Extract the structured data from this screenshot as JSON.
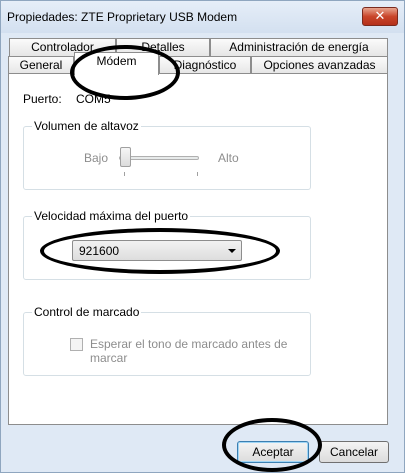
{
  "window": {
    "title": "Propiedades: ZTE Proprietary USB Modem",
    "close_glyph": "✕"
  },
  "tabs": {
    "row_back": [
      {
        "label": "Controlador"
      },
      {
        "label": "Detalles"
      },
      {
        "label": "Administración de energía"
      }
    ],
    "row_front": [
      {
        "label": "General"
      },
      {
        "label": "Módem"
      },
      {
        "label": "Diagnóstico"
      },
      {
        "label": "Opciones avanzadas"
      }
    ]
  },
  "modem_tab": {
    "port_label": "Puerto:",
    "port_value": "COM5",
    "speaker_volume": {
      "title": "Volumen de altavoz",
      "low_label": "Bajo",
      "high_label": "Alto",
      "level_fraction": 0
    },
    "max_port_speed": {
      "title": "Velocidad máxima del puerto",
      "selected": "921600"
    },
    "dial_control": {
      "title": "Control de marcado",
      "wait_dial_tone_label": "Esperar el tono de marcado antes de marcar",
      "wait_dial_tone_checked": false
    }
  },
  "footer": {
    "ok_label": "Aceptar",
    "cancel_label": "Cancelar"
  },
  "colors": {
    "window_bg": "#dfe9f5",
    "close_red": "#c9452a",
    "annotation": "#000000"
  }
}
